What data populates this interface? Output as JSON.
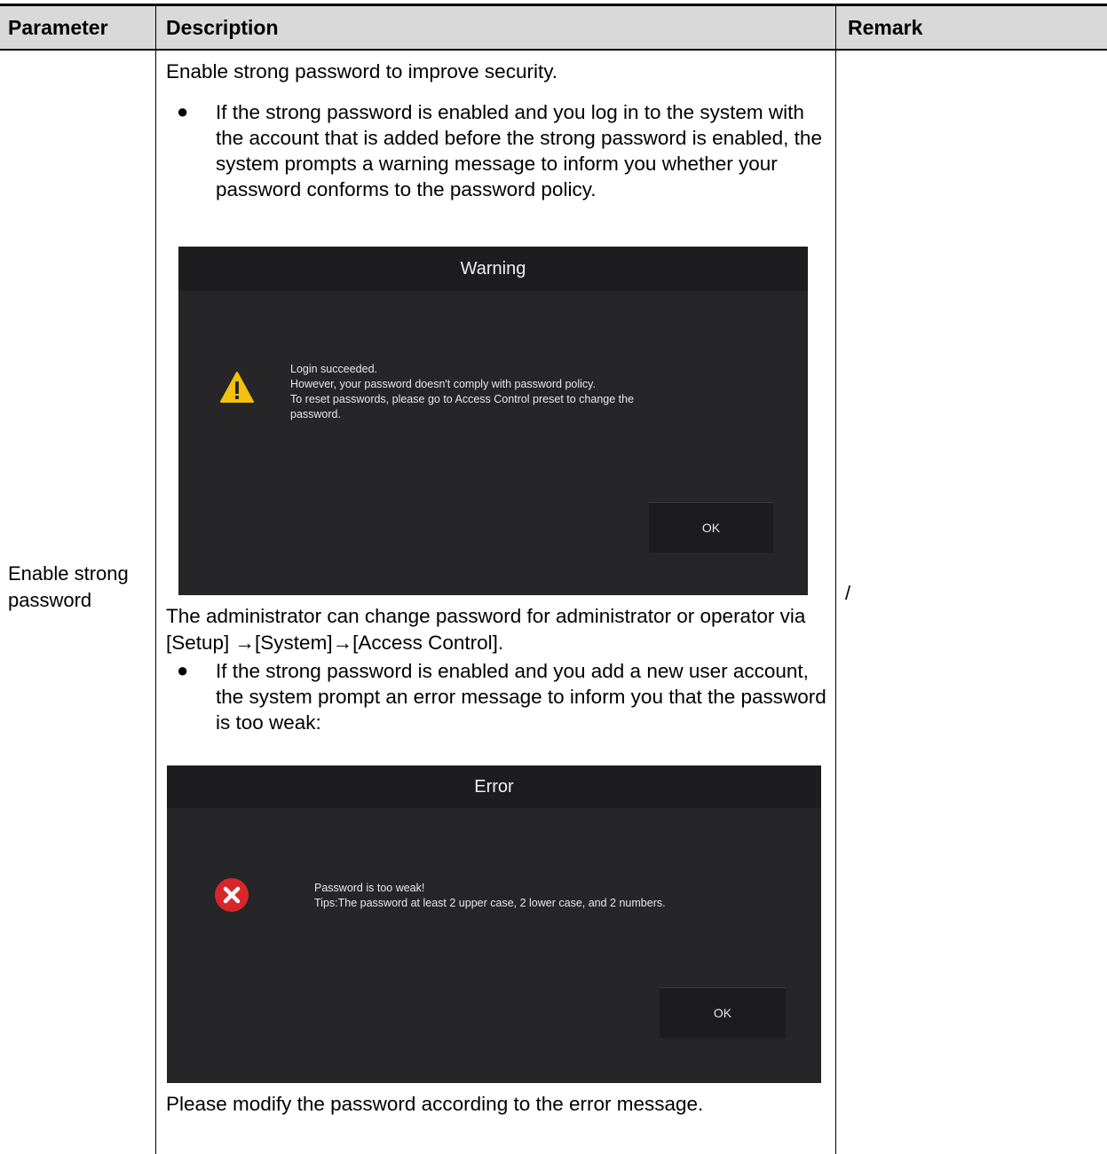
{
  "table": {
    "headers": [
      "Parameter",
      "Description",
      "Remark"
    ],
    "parameter": "Enable strong password",
    "remark": "/"
  },
  "description": {
    "intro": "Enable strong password to improve security.",
    "bullet1": "If the strong password is enabled and you log in to the system with the account that is added before the strong password is enabled, the system prompts a warning message to inform you whether your password conforms to the password policy.",
    "middle": "The administrator can change password for administrator or operator via [Setup] →[System]→[Access Control].",
    "bullet2": "If the strong password is enabled and you add a new user account, the system prompt an error message to inform you that the password is too weak:",
    "outro": "Please modify the password according to the error message."
  },
  "warning_dialog": {
    "title": "Warning",
    "lines": [
      "Login succeeded.",
      "However, your password doesn't comply with password policy.",
      "To reset passwords, please go to Access Control preset to change the",
      "password."
    ],
    "ok_label": "OK",
    "icon": "warning-triangle-icon",
    "icon_color": "#f4c20d"
  },
  "error_dialog": {
    "title": "Error",
    "lines": [
      "Password is too weak!",
      "Tips:The password at least 2 upper case, 2 lower case, and 2 numbers."
    ],
    "ok_label": "OK",
    "icon": "error-x-icon",
    "icon_color": "#d9262b"
  }
}
